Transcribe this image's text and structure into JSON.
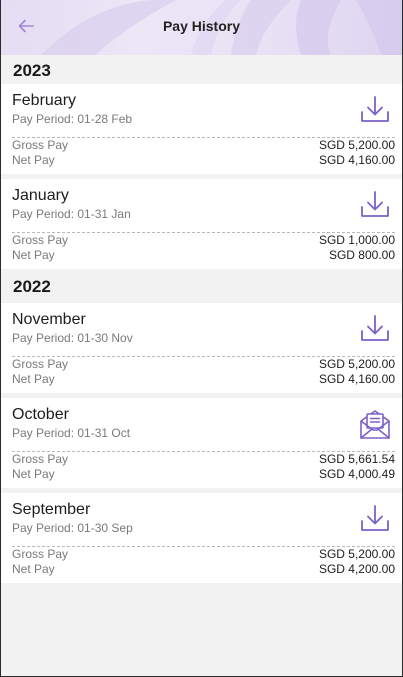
{
  "header": {
    "title": "Pay History",
    "back_icon": "back-arrow-icon"
  },
  "colors": {
    "accent": "#7b61c9",
    "header_bg": "#e8e1f5",
    "page_bg": "#f2f2f3"
  },
  "groups": [
    {
      "year": "2023",
      "items": [
        {
          "month": "February",
          "period": "Pay Period: 01-28 Feb",
          "gross_label": "Gross Pay",
          "gross_value": "SGD 5,200.00",
          "net_label": "Net Pay",
          "net_value": "SGD 4,160.00",
          "icon": "download-icon"
        },
        {
          "month": "January",
          "period": "Pay Period: 01-31 Jan",
          "gross_label": "Gross Pay",
          "gross_value": "SGD 1,000.00",
          "net_label": "Net Pay",
          "net_value": "SGD 800.00",
          "icon": "download-icon"
        }
      ]
    },
    {
      "year": "2022",
      "items": [
        {
          "month": "November",
          "period": "Pay Period: 01-30 Nov",
          "gross_label": "Gross Pay",
          "gross_value": "SGD 5,200.00",
          "net_label": "Net Pay",
          "net_value": "SGD 4,160.00",
          "icon": "download-icon"
        },
        {
          "month": "October",
          "period": "Pay Period: 01-31 Oct",
          "gross_label": "Gross Pay",
          "gross_value": "SGD 5,661.54",
          "net_label": "Net Pay",
          "net_value": "SGD 4,000.49",
          "icon": "open-envelope-icon"
        },
        {
          "month": "September",
          "period": "Pay Period: 01-30 Sep",
          "gross_label": "Gross Pay",
          "gross_value": "SGD 5,200.00",
          "net_label": "Net Pay",
          "net_value": "SGD 4,200.00",
          "icon": "download-icon"
        }
      ]
    }
  ]
}
